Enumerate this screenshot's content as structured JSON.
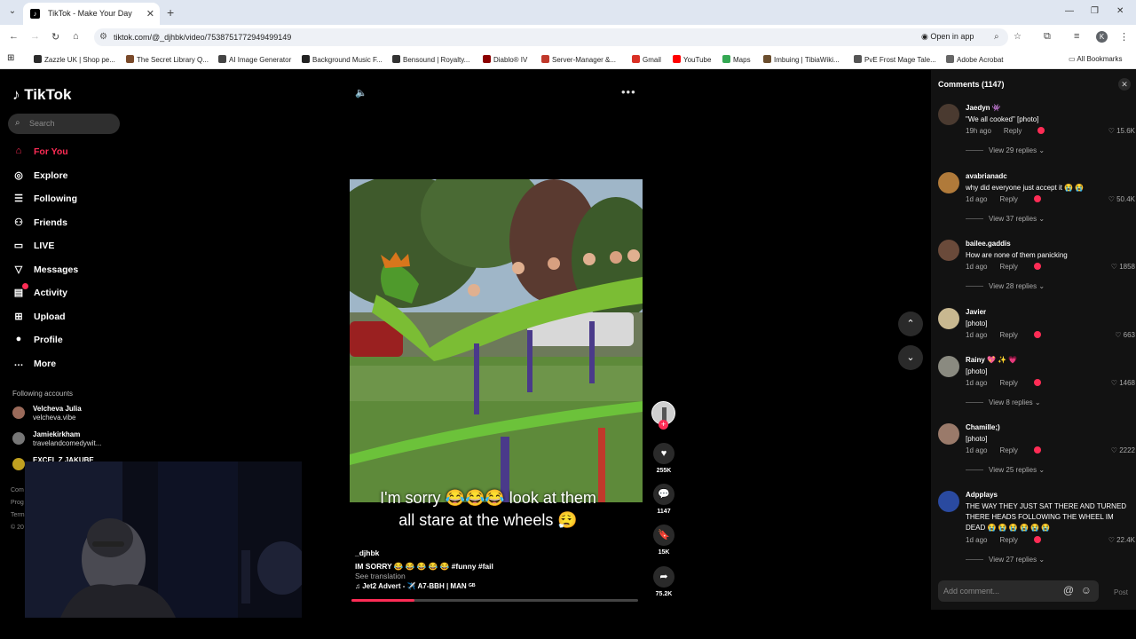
{
  "browser": {
    "tab_title": "TikTok - Make Your Day",
    "url": "tiktok.com/@_djhbk/video/7538751772949499149",
    "open_in_app": "Open in app",
    "avatar_letter": "K",
    "bookmarks": [
      {
        "label": "Zazzle UK | Shop pe...",
        "color": "#2b2b2b"
      },
      {
        "label": "The Secret Library Q...",
        "color": "#7a4a2a"
      },
      {
        "label": "AI Image Generator",
        "color": "#444444"
      },
      {
        "label": "Background Music F...",
        "color": "#222222"
      },
      {
        "label": "Bensound | Royalty...",
        "color": "#333333"
      },
      {
        "label": "Diablo® IV",
        "color": "#8b0000"
      },
      {
        "label": "Server-Manager &...",
        "color": "#c0392b"
      },
      {
        "label": "Gmail",
        "color": "#d93025"
      },
      {
        "label": "YouTube",
        "color": "#ff0000"
      },
      {
        "label": "Maps",
        "color": "#34a853"
      },
      {
        "label": "Imbuing | TibiaWiki...",
        "color": "#6b4e2e"
      },
      {
        "label": "PvE Frost Mage Tale...",
        "color": "#555555"
      },
      {
        "label": "Adobe Acrobat",
        "color": "#666666"
      }
    ],
    "all_bookmarks": "All Bookmarks"
  },
  "sidebar": {
    "logo": "TikTok",
    "search_placeholder": "Search",
    "nav": [
      {
        "label": "For You",
        "icon": "home-icon"
      },
      {
        "label": "Explore",
        "icon": "compass-icon"
      },
      {
        "label": "Following",
        "icon": "following-icon"
      },
      {
        "label": "Friends",
        "icon": "friends-icon"
      },
      {
        "label": "LIVE",
        "icon": "live-icon"
      },
      {
        "label": "Messages",
        "icon": "messages-icon"
      },
      {
        "label": "Activity",
        "icon": "activity-icon"
      },
      {
        "label": "Upload",
        "icon": "upload-icon"
      },
      {
        "label": "Profile",
        "icon": "profile-icon"
      },
      {
        "label": "More",
        "icon": "more-icon"
      }
    ],
    "following_title": "Following accounts",
    "following": [
      {
        "name": "Velcheva Julia",
        "user": "velcheva.vibe"
      },
      {
        "name": "Jamiekirkham",
        "user": "travelandcomedywit..."
      },
      {
        "name": "EXCEL Z JAKUBE",
        "user": ""
      }
    ]
  },
  "video": {
    "caption_line1": "I'm sorry 😂😂😂 look at them",
    "caption_line2": "all stare at the wheels 😮‍💨",
    "author": "_djhbk",
    "description": "IM SORRY 😂 😂 😂 😂 😂 #funny #fail",
    "see_translation": "See translation",
    "music": "♫ Jet2 Advert - ✈️ A7-BBH | MAN ᴳᴮ",
    "progress": 0.22,
    "likes": "255K",
    "comments": "1147",
    "saves": "15K",
    "shares": "75.2K"
  },
  "comments_panel": {
    "title": "Comments (1147)",
    "input_placeholder": "Add comment...",
    "post_label": "Post",
    "items": [
      {
        "user": "Jaedyn 👾",
        "text": "\"We all cooked\" [photo]",
        "time": "19h ago",
        "reply": "Reply",
        "likes": "15.6K",
        "view_replies": "View 29 replies ⌄",
        "avatar_color": "#4a3a30"
      },
      {
        "user": "avabrianadc",
        "text": "why did everyone just accept it 😭 😭",
        "time": "1d ago",
        "reply": "Reply",
        "likes": "50.4K",
        "view_replies": "View 37 replies ⌄",
        "avatar_color": "#b07a3a"
      },
      {
        "user": "bailee.gaddis",
        "text": "How are none of them panicking",
        "time": "1d ago",
        "reply": "Reply",
        "likes": "1858",
        "view_replies": "View 28 replies ⌄",
        "avatar_color": "#6a4a3a"
      },
      {
        "user": "Javier",
        "text": "[photo]",
        "time": "1d ago",
        "reply": "Reply",
        "likes": "663",
        "view_replies": "",
        "avatar_color": "#c8b890"
      },
      {
        "user": "Rainy 💖 ✨ 💗",
        "text": "[photo]",
        "time": "1d ago",
        "reply": "Reply",
        "likes": "1468",
        "view_replies": "View 8 replies ⌄",
        "avatar_color": "#8a8a80"
      },
      {
        "user": "Chamille;)",
        "text": "[photo]",
        "time": "1d ago",
        "reply": "Reply",
        "likes": "2222",
        "view_replies": "View 25 replies ⌄",
        "avatar_color": "#9a7a6a"
      },
      {
        "user": "Adpplays",
        "text": "THE WAY THEY JUST SAT THERE AND TURNED THERE HEADS FOLLOWING THE WHEEL IM DEAD 😭 😭 😭 😭 😭 😭",
        "time": "1d ago",
        "reply": "Reply",
        "likes": "22.4K",
        "view_replies": "View 27 replies ⌄",
        "avatar_color": "#2a4aa0"
      }
    ]
  },
  "colors": {
    "accent": "#fe2c55",
    "panel": "#121212",
    "page": "#000000"
  }
}
